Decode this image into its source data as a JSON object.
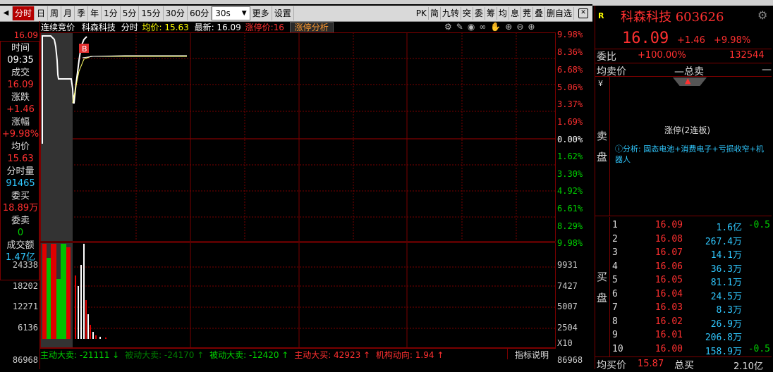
{
  "toolbar": {
    "tabs": [
      "分时",
      "日",
      "周",
      "月",
      "季",
      "年",
      "1分",
      "5分",
      "15分",
      "30分",
      "60分"
    ],
    "period_select": "30s",
    "more": "更多",
    "settings": "设置",
    "right_buttons": [
      "PK",
      "简",
      "九转",
      "突",
      "委",
      "筹",
      "均",
      "息",
      "茺",
      "叠",
      "删自选"
    ]
  },
  "left_panel": [
    {
      "label": "时间",
      "value": "09:35",
      "color": "white"
    },
    {
      "label": "成交",
      "value": "16.09",
      "color": "red"
    },
    {
      "label": "涨跌",
      "value": "+1.46",
      "color": "red"
    },
    {
      "label": "涨幅",
      "value": "+9.98%",
      "color": "red"
    },
    {
      "label": "均价",
      "value": "15.63",
      "color": "red"
    },
    {
      "label": "分时量",
      "value": "91465",
      "color": "cyan"
    },
    {
      "label": "委买",
      "value": "18.89万",
      "color": "red"
    },
    {
      "label": "委卖",
      "value": "0",
      "color": "green"
    },
    {
      "label": "成交额",
      "value": "1.47亿",
      "color": "cyan"
    }
  ],
  "price_axis_left": {
    "top": "16.09"
  },
  "volume_axis_left": [
    "24338",
    "18202",
    "12271",
    "6136",
    "86968"
  ],
  "chart_header": {
    "auction": "连续竞价",
    "name": "科森科技",
    "mode": "分时",
    "avg_label": "均价: 15.63",
    "latest_label": "最新: 16.09",
    "limit_label": "涨停价:16",
    "limit_analysis": "涨停分析"
  },
  "right_axis_pct": [
    "9.98%",
    "8.36%",
    "6.68%",
    "5.06%",
    "3.37%",
    "1.69%",
    "0.00%",
    "1.62%",
    "3.30%",
    "4.92%",
    "6.61%",
    "8.29%",
    "9.98%"
  ],
  "right_axis_vol": [
    "9931",
    "7427",
    "5007",
    "2504",
    "X10",
    "86968"
  ],
  "marker_b": "B",
  "bottom_bar": {
    "items": [
      {
        "text": "主动大卖: -21111 ↓",
        "color": "green"
      },
      {
        "text": "被动大卖: -24170 ↑",
        "color": "green"
      },
      {
        "text": "被动大卖: -12420 ↑",
        "color": "green"
      },
      {
        "text": "主动大买: 42923 ↑",
        "color": "red"
      },
      {
        "text": "机构动向: 1.94 ↑",
        "color": "red"
      }
    ],
    "indicator_btn": "指标说明"
  },
  "stock": {
    "r_icon": "R",
    "name_code": "科森科技 603626",
    "price": "16.09",
    "change": "+1.46",
    "pct": "+9.98%",
    "weibi_label": "委比",
    "weibi_val": "+100.00%",
    "weibi_num": "132544",
    "sell_avg_label": "均卖价",
    "sell_avg_val": "—总卖",
    "sell_avg_dash": "—",
    "sell_label": "卖盘",
    "yen": "¥",
    "limit_text": "涨停(2连板)",
    "analysis": "ⓘ分析: 固态电池+消费电子+亏损收窄+机器人",
    "buy_label": "买盘",
    "buy_avg_label": "均买价",
    "buy_avg_val": "15.87",
    "total_buy_label": "总买",
    "total_buy_val": "2.10亿"
  },
  "order_book": [
    {
      "lvl": "1",
      "price": "16.09",
      "vol": "1.6亿",
      "chg": "-0.5"
    },
    {
      "lvl": "2",
      "price": "16.08",
      "vol": "267.4万",
      "chg": ""
    },
    {
      "lvl": "3",
      "price": "16.07",
      "vol": "14.1万",
      "chg": ""
    },
    {
      "lvl": "4",
      "price": "16.06",
      "vol": "36.3万",
      "chg": ""
    },
    {
      "lvl": "5",
      "price": "16.05",
      "vol": "81.1万",
      "chg": ""
    },
    {
      "lvl": "6",
      "price": "16.04",
      "vol": "24.5万",
      "chg": ""
    },
    {
      "lvl": "7",
      "price": "16.03",
      "vol": "8.3万",
      "chg": ""
    },
    {
      "lvl": "8",
      "price": "16.02",
      "vol": "26.9万",
      "chg": ""
    },
    {
      "lvl": "9",
      "price": "16.01",
      "vol": "206.8万",
      "chg": ""
    },
    {
      "lvl": "10",
      "price": "16.00",
      "vol": "158.9万",
      "chg": "-0.5"
    }
  ],
  "colors": {
    "accent": "#ff3030",
    "down": "#00d000",
    "grid": "#7a0000",
    "info": "#30c8ff"
  }
}
